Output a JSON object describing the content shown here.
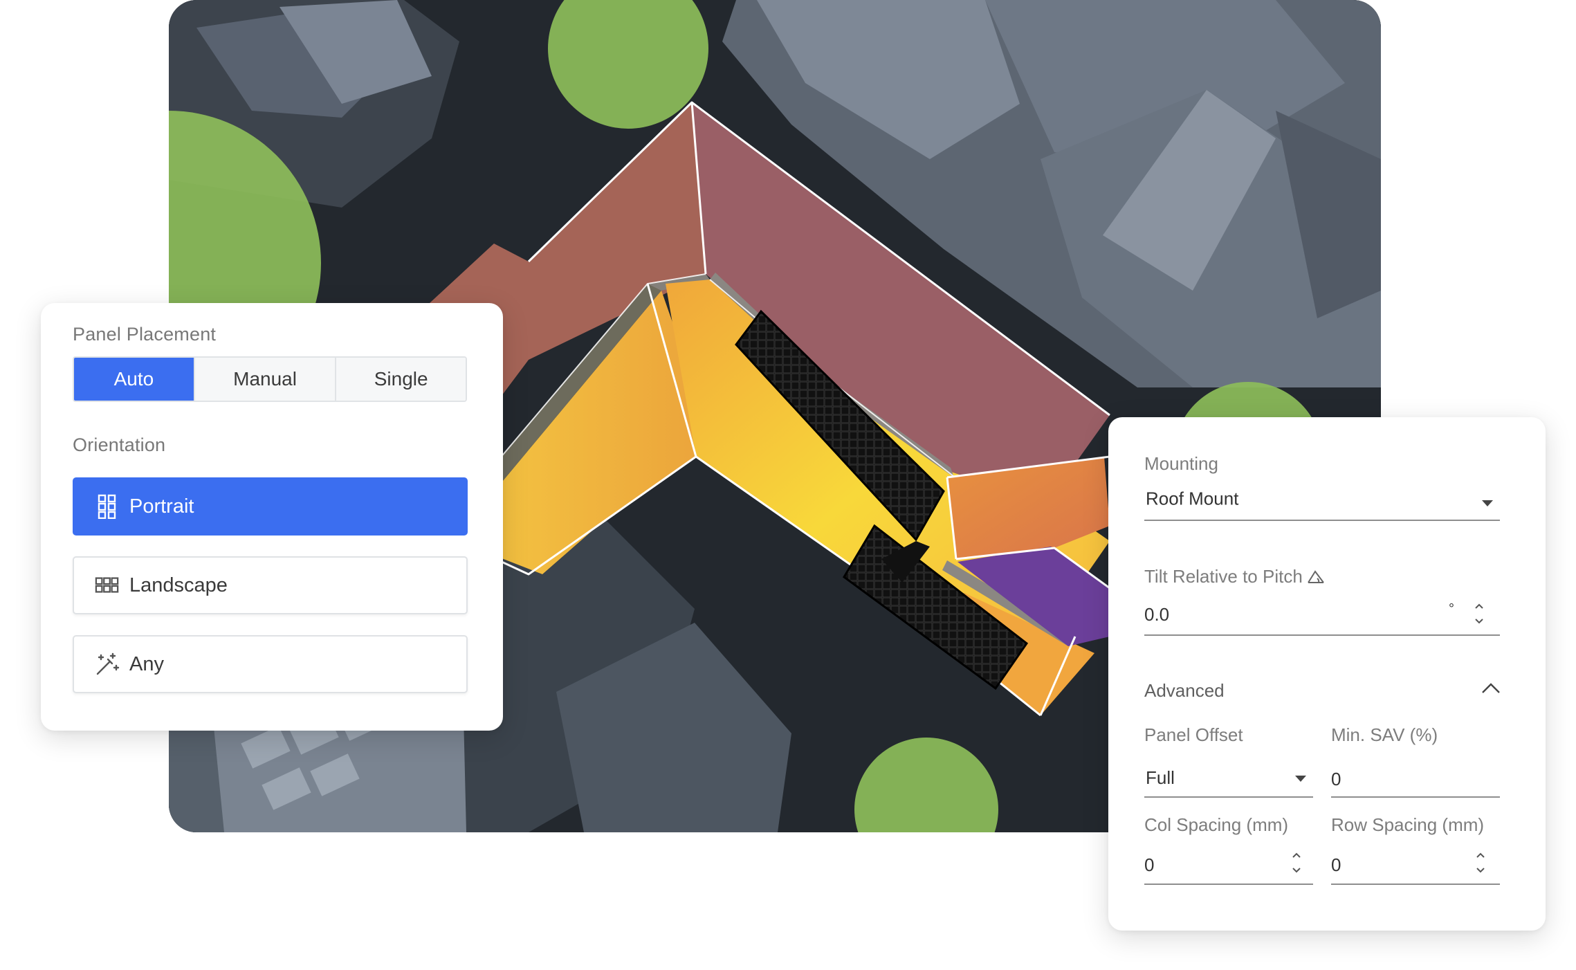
{
  "left_panel": {
    "placement_label": "Panel Placement",
    "placement_options": [
      "Auto",
      "Manual",
      "Single"
    ],
    "placement_selected": "Auto",
    "orientation_label": "Orientation",
    "orientation_options": [
      {
        "label": "Portrait",
        "icon": "grid-portrait-icon",
        "selected": true
      },
      {
        "label": "Landscape",
        "icon": "grid-landscape-icon",
        "selected": false
      },
      {
        "label": "Any",
        "icon": "magic-wand-icon",
        "selected": false
      }
    ]
  },
  "right_panel": {
    "mounting_label": "Mounting",
    "mounting_value": "Roof Mount",
    "tilt_label": "Tilt Relative to Pitch",
    "tilt_value": "0.0",
    "tilt_unit": "°",
    "advanced_label": "Advanced",
    "panel_offset_label": "Panel Offset",
    "panel_offset_value": "Full",
    "min_sav_label": "Min. SAV (%)",
    "min_sav_value": "0",
    "col_spacing_label": "Col Spacing (mm)",
    "col_spacing_value": "0",
    "row_spacing_label": "Row Spacing (mm)",
    "row_spacing_value": "0"
  },
  "colors": {
    "accent": "#3b6ef0",
    "tree": "#8dbd5a",
    "roof_high": "#f5c43a",
    "roof_low": "#a4606a",
    "roof_shade": "#6b3f9a"
  }
}
